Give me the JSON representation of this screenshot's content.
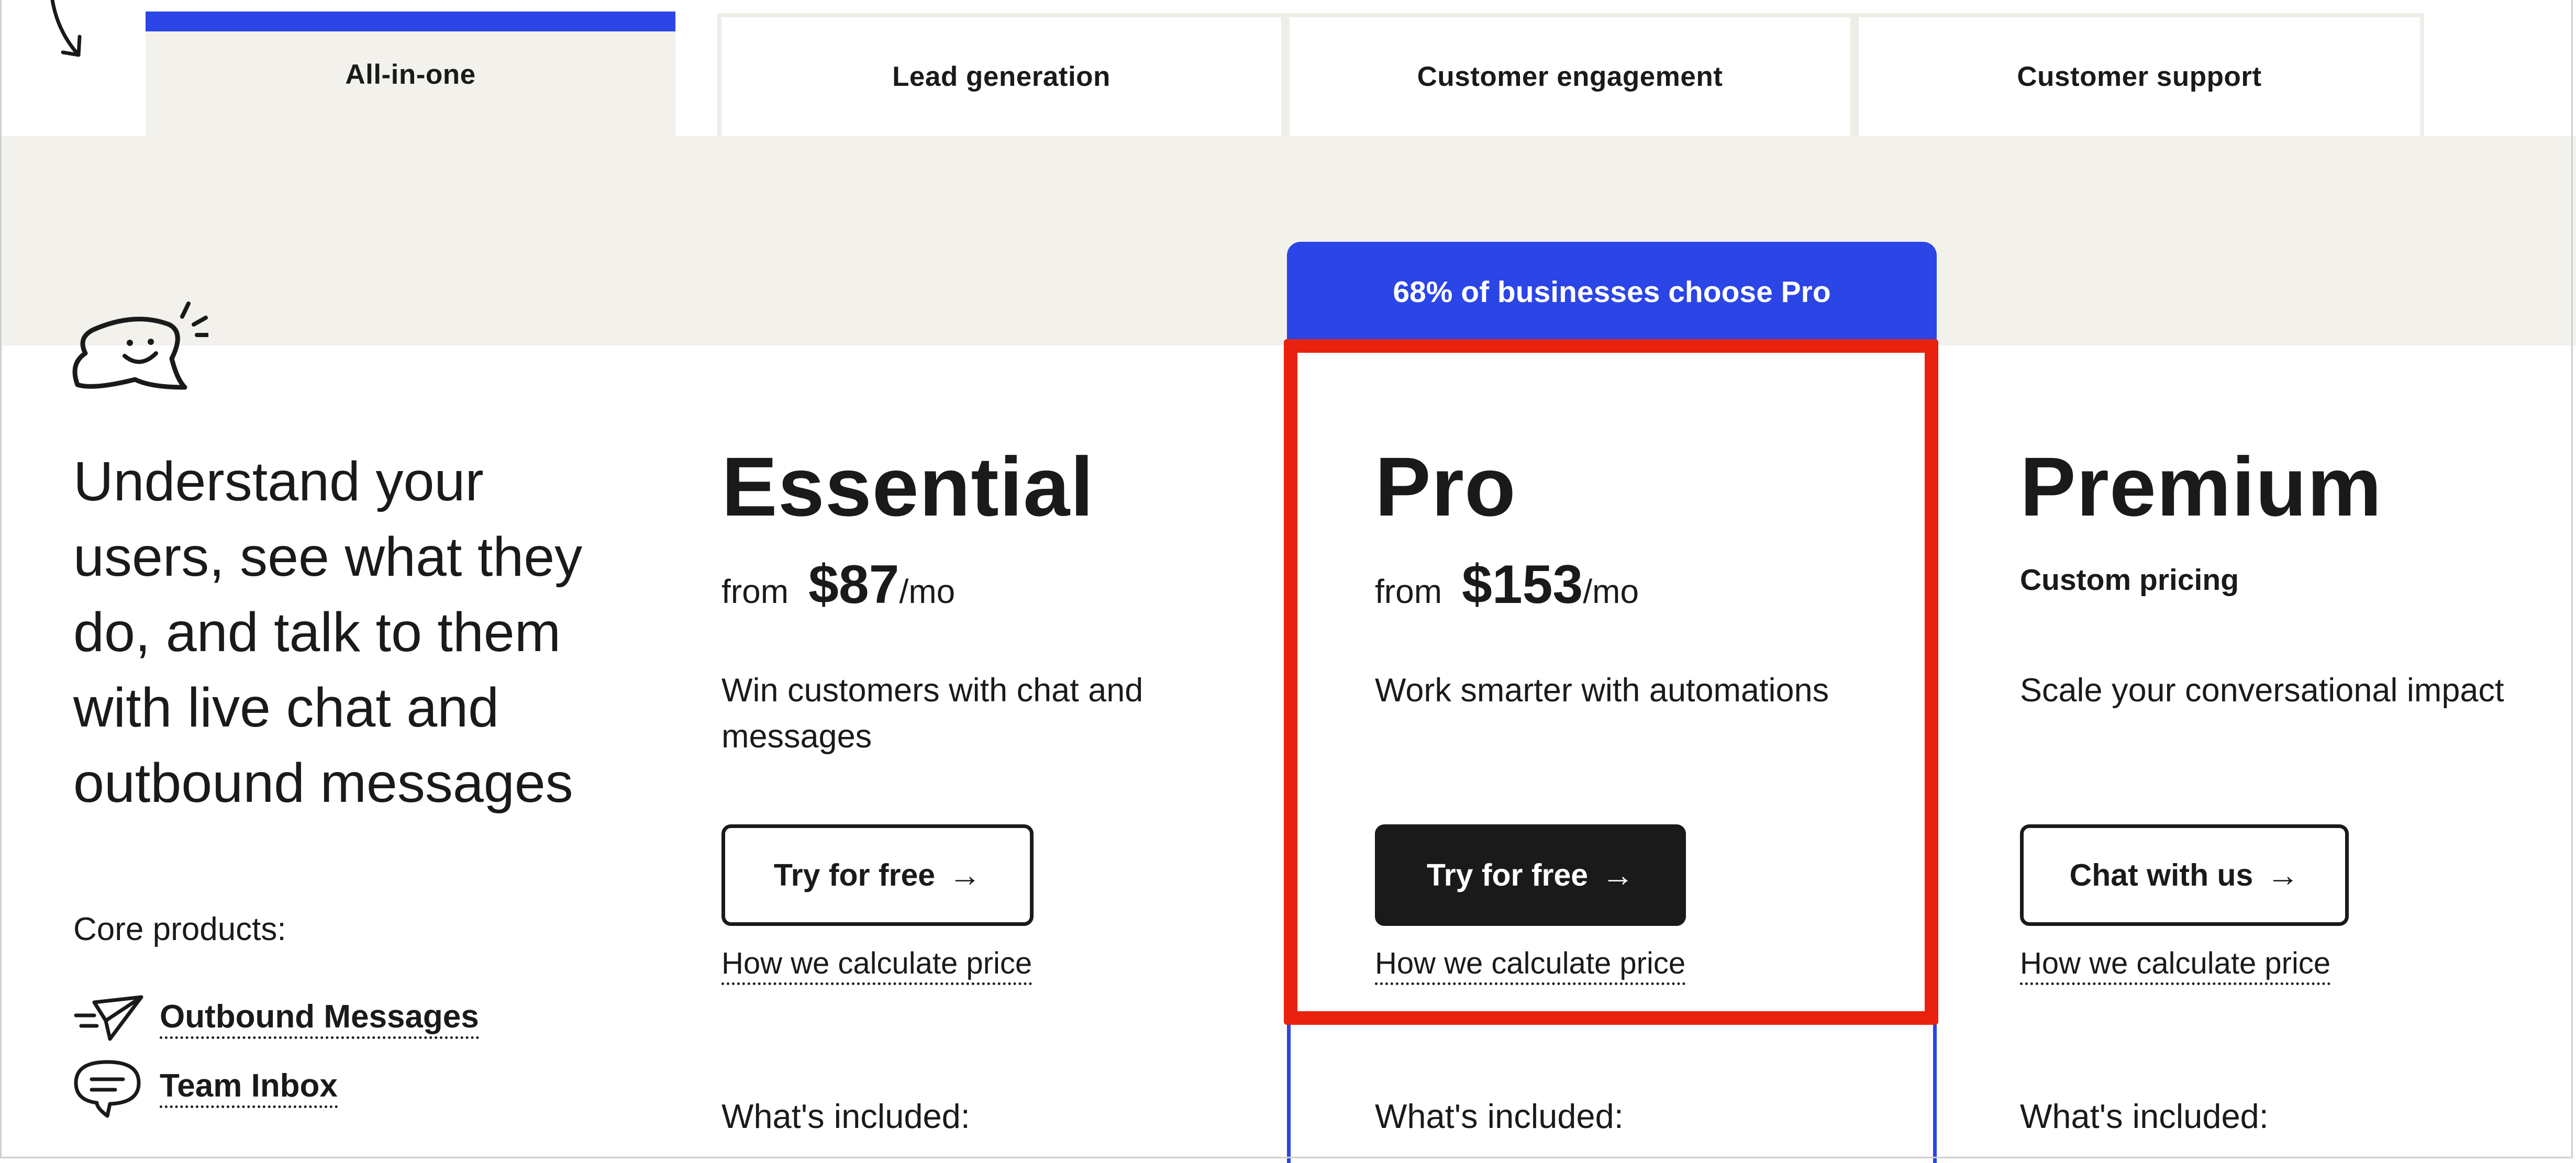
{
  "tabs": [
    {
      "label": "All-in-one",
      "active": true
    },
    {
      "label": "Lead generation",
      "active": false
    },
    {
      "label": "Customer engagement",
      "active": false
    },
    {
      "label": "Customer support",
      "active": false
    }
  ],
  "badge": "68% of businesses choose Pro",
  "intro": {
    "headline_lines": [
      "Understand your",
      "users, see what they",
      "do, and talk to them",
      "with live chat and",
      "outbound messages"
    ],
    "core_label": "Core products:",
    "core_products": [
      {
        "label": "Outbound Messages",
        "icon": "paper-plane-icon"
      },
      {
        "label": "Team Inbox",
        "icon": "chat-bubble-icon"
      }
    ]
  },
  "plans": [
    {
      "name": "Essential",
      "from": "from",
      "amount": "$87",
      "per": "/mo",
      "description": "Win customers with chat and messages",
      "button": "Try for free",
      "calc": "How we calculate price",
      "included": "What's included:"
    },
    {
      "name": "Pro",
      "from": "from",
      "amount": "$153",
      "per": "/mo",
      "description": "Work smarter with automations",
      "button": "Try for free",
      "calc": "How we calculate price",
      "included": "What's included:"
    },
    {
      "name": "Premium",
      "custom": "Custom pricing",
      "description": "Scale your conversational impact",
      "button": "Chat with us",
      "calc": "How we calculate price",
      "included": "What's included:"
    }
  ],
  "arrow_glyph": "→",
  "colors": {
    "accent_blue": "#2b45e6",
    "highlight_red": "#e8220f",
    "beige": "#f3f1ec",
    "dark": "#1a1a1a"
  }
}
